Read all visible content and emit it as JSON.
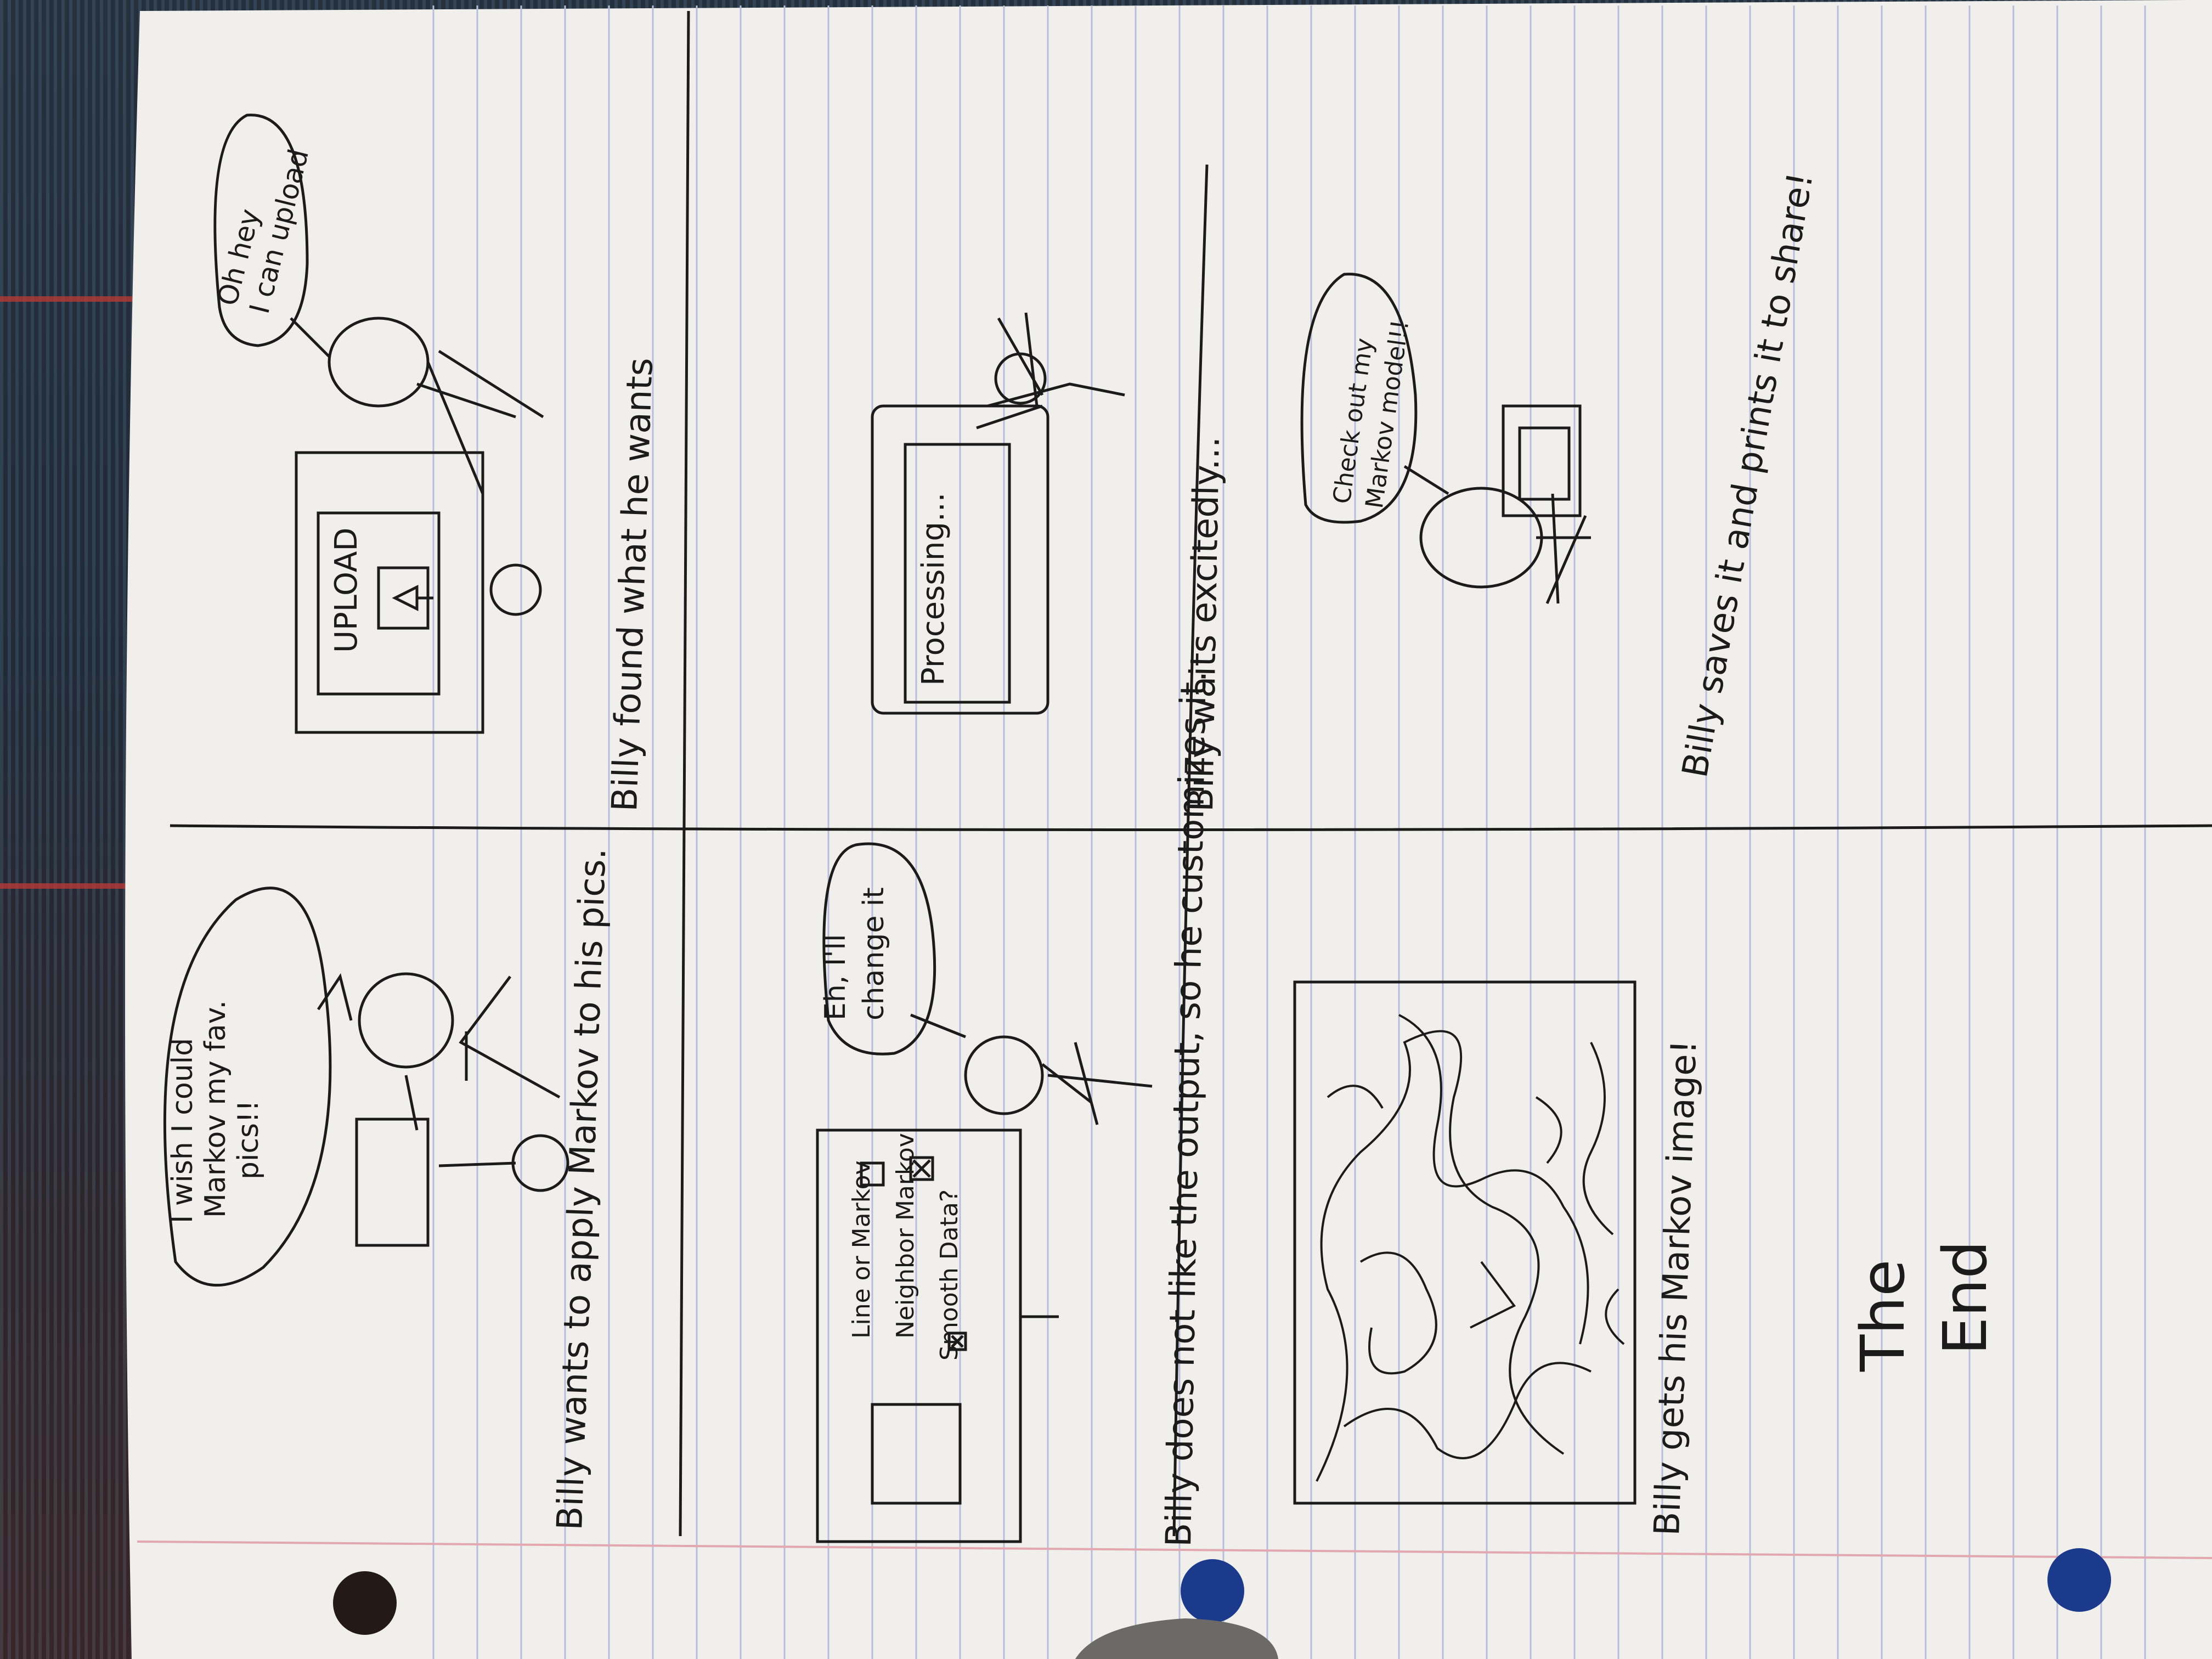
{
  "panel1": {
    "bubble": [
      "I wish I could",
      "Markov my fav.",
      "pics!!"
    ],
    "caption": "Billy wants to apply Markov to his pics."
  },
  "panel2": {
    "bubble": [
      "Oh hey",
      "I can upload"
    ],
    "upload_label": "UPLOAD",
    "caption": "Billy found what he wants"
  },
  "panel3": {
    "options": [
      "Line or Markov",
      "Neighbor Markov",
      "Smooth Data?"
    ],
    "bubble": [
      "Eh, I'll",
      "change it"
    ],
    "caption": "Billy does not like the output, so he customizes it."
  },
  "panel4": {
    "screen_text": "Processing...",
    "caption": "Billy waits excitedly..."
  },
  "panel5": {
    "caption": "Billy gets his Markov image!"
  },
  "panel6": {
    "bubble": [
      "Check out my",
      "Markov model!!"
    ],
    "caption": "Billy saves it and prints it to share!"
  },
  "ending": [
    "The",
    "End"
  ]
}
